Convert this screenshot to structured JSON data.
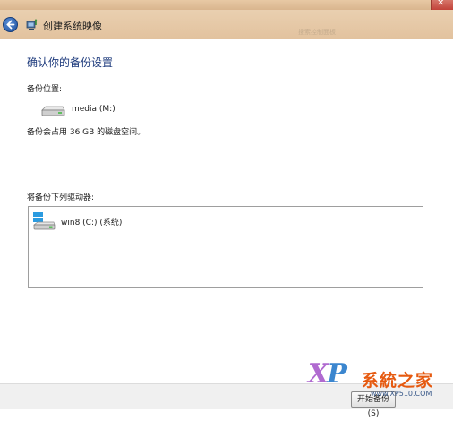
{
  "window": {
    "title": "创建系统映像",
    "close_glyph": "✕",
    "search_hint": "搜索控制面板"
  },
  "main": {
    "heading": "确认你的备份设置",
    "location_label": "备份位置:",
    "target_drive": {
      "name": "media (M:)",
      "icon": "hard-drive-icon"
    },
    "space_note": "备份会占用 36 GB 的磁盘空间。",
    "drives_label": "将备份下列驱动器:",
    "drives": [
      {
        "label": "win8 (C:) (系统)",
        "icon": "windows-drive-icon"
      }
    ]
  },
  "footer": {
    "start_button": "开始备份(S)"
  },
  "watermark": {
    "brand": "XP",
    "chinese": "系統之家",
    "url": "www.XP510.COM"
  },
  "colors": {
    "header": "#e2c29e",
    "heading": "#1d3a7c",
    "watermark_orange": "#e65a10",
    "watermark_purple": "#b06ad0"
  }
}
